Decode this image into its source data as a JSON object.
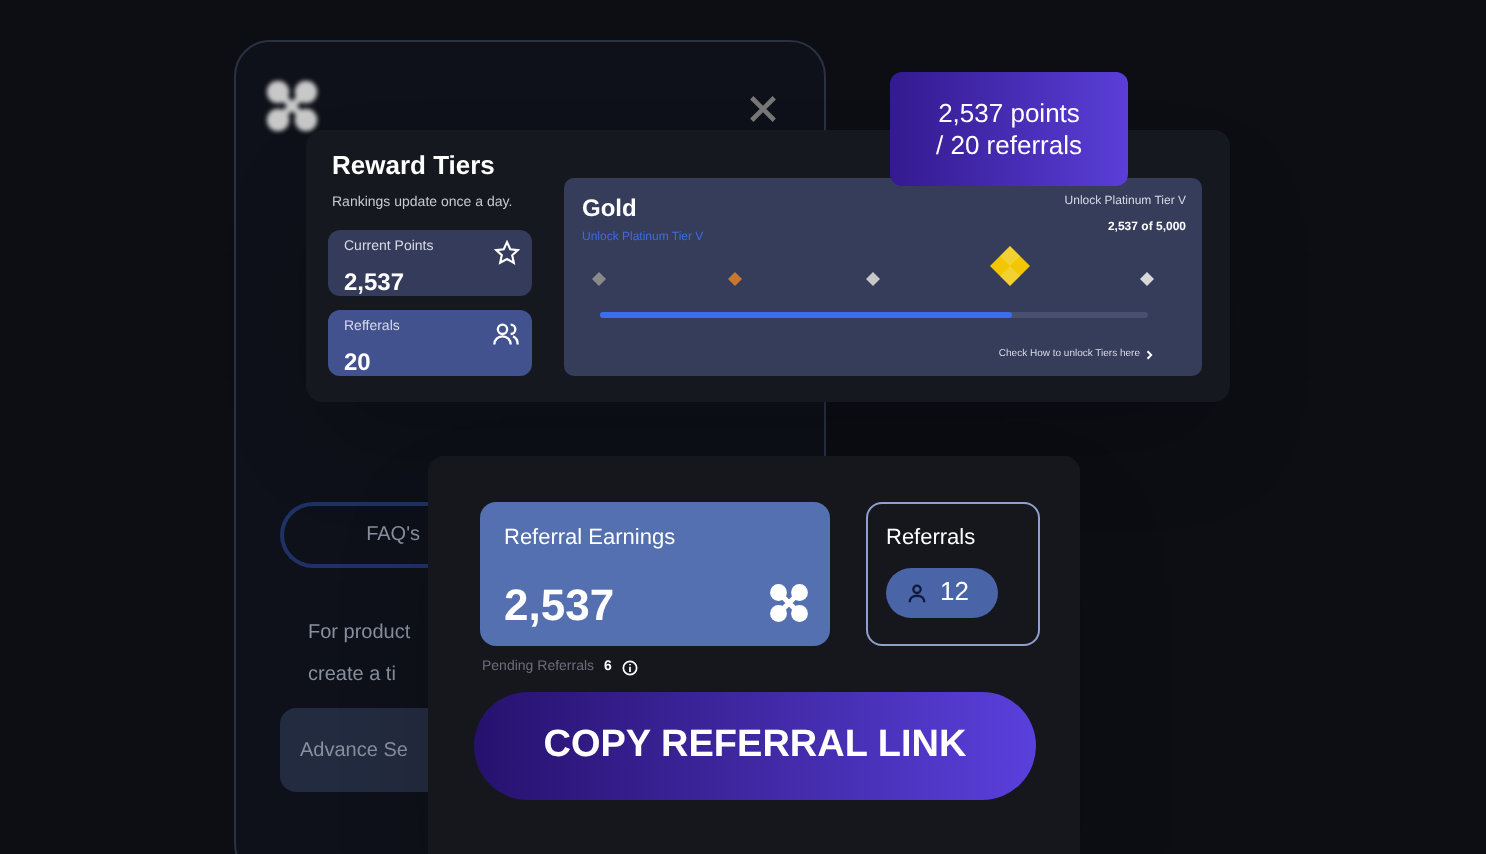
{
  "back_panel": {
    "faq_button": "FAQ's",
    "help_text": [
      "For product",
      "create a ti"
    ],
    "advance_button": "Advance Se"
  },
  "reward_tiers": {
    "title": "Reward Tiers",
    "subtitle": "Rankings update once a day.",
    "stats": [
      {
        "label": "Current Points",
        "value": "2,537",
        "kind": "points"
      },
      {
        "label": "Refferals",
        "value": "20",
        "kind": "referrals"
      }
    ],
    "tier_card": {
      "name": "Gold",
      "unlock_link": "Unlock Platinum Tier V",
      "unlock_label": "Unlock Platinum Tier V",
      "progress_text": "2,537 of 5,000",
      "level": 0.75,
      "help_link": "Check How to unlock Tiers here",
      "tiers": [
        {
          "color": "#8a8a8a",
          "selected": false
        },
        {
          "color": "#c9772e",
          "selected": false
        },
        {
          "color": "#c8c8c8",
          "selected": false
        },
        {
          "color": "#f2c600",
          "selected": true
        },
        {
          "color": "#d8d8d8",
          "selected": false
        }
      ]
    },
    "tooltip": [
      "2,537 points",
      "/ 20 referrals"
    ]
  },
  "referral_card": {
    "earnings_label": "Referral Earnings",
    "earnings_value": "2,537",
    "referrals_label": "Referrals",
    "referrals_count": "12",
    "pending_label": "Pending Referrals",
    "pending_count": "6",
    "copy_button": "COPY REFERRAL LINK"
  }
}
